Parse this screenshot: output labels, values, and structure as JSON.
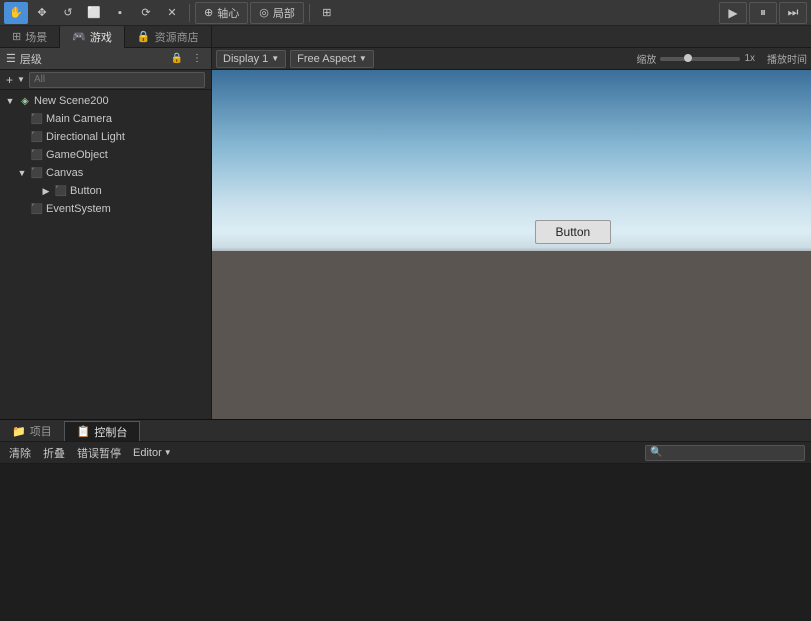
{
  "toolbar": {
    "tools": [
      "⊕",
      "✥",
      "↺",
      "⬜",
      "⬛",
      "⟳",
      "✕"
    ],
    "pivot_label": "轴心",
    "local_label": "局部",
    "grid_label": "⊞",
    "play_btn": "▶",
    "pause_btn": "⏸",
    "step_btn": "⏭"
  },
  "tabs": [
    {
      "label": "场景",
      "icon": "⊞",
      "active": false
    },
    {
      "label": "游戏",
      "icon": "🎮",
      "active": true
    },
    {
      "label": "资源商店",
      "icon": "🔒",
      "active": false
    }
  ],
  "layers_panel": {
    "title": "层级",
    "search_placeholder": "All"
  },
  "hierarchy": {
    "scene_name": "New Scene200",
    "items": [
      {
        "label": "Main Camera",
        "indent": 1,
        "icon": "cube",
        "has_arrow": false
      },
      {
        "label": "Directional Light",
        "indent": 1,
        "icon": "light",
        "has_arrow": false
      },
      {
        "label": "GameObject",
        "indent": 1,
        "icon": "cube",
        "has_arrow": false
      },
      {
        "label": "Canvas",
        "indent": 1,
        "icon": "canvas",
        "has_arrow": true,
        "expanded": true
      },
      {
        "label": "Button",
        "indent": 3,
        "icon": "btn",
        "has_arrow": false
      },
      {
        "label": "EventSystem",
        "indent": 1,
        "icon": "evtsys",
        "has_arrow": false
      }
    ]
  },
  "game_view": {
    "display_label": "Display 1",
    "aspect_label": "Free Aspect",
    "scale_label": "缩放",
    "scale_value": "1x",
    "playback_label": "播放时间",
    "button_label": "Button"
  },
  "bottom_panel": {
    "tabs": [
      {
        "label": "项目",
        "icon": "📁",
        "active": false
      },
      {
        "label": "控制台",
        "icon": "📋",
        "active": true
      }
    ],
    "console_toolbar": [
      {
        "label": "清除"
      },
      {
        "label": "折叠"
      },
      {
        "label": "错误暂停"
      },
      {
        "label": "Editor",
        "has_dropdown": true
      }
    ],
    "search_placeholder": "🔍"
  }
}
